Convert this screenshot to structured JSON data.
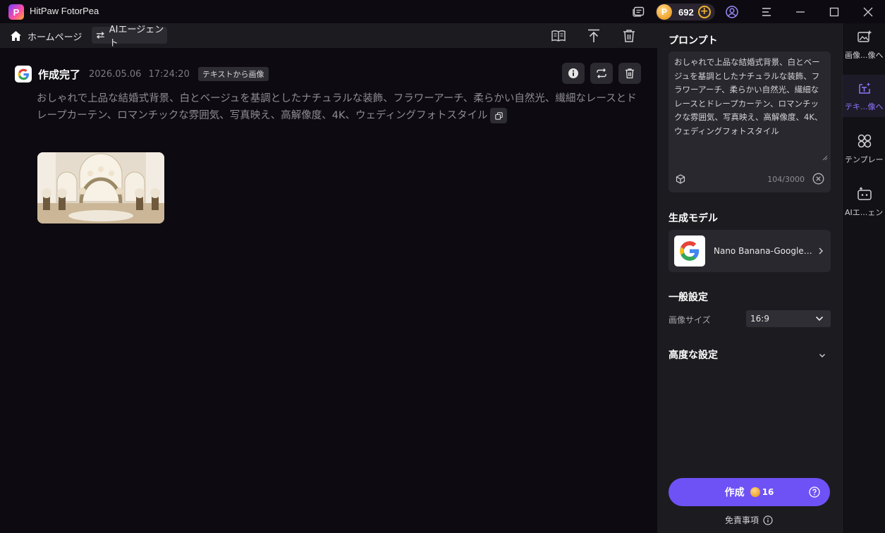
{
  "titlebar": {
    "app_name": "HitPaw FotorPea",
    "logo_letter": "P",
    "coin_symbol": "P",
    "coin_count": "692",
    "coin_plus": "+"
  },
  "toolbar": {
    "home_label": "ホームページ",
    "agent_label": "AIエージェント"
  },
  "result": {
    "title": "作成完了",
    "date": "2026.05.06",
    "time": "17:24:20",
    "tag": "テキストから画像",
    "prompt": "おしゃれで上品な結婚式背景、白とベージュを基調としたナチュラルな装飾、フラワーアーチ、柔らかい自然光、繊細なレースとドレープカーテン、ロマンチックな雰囲気、写真映え、高解像度、4K、ウェディングフォトスタイル"
  },
  "panel": {
    "prompt_title": "プロンプト",
    "prompt_value": "おしゃれで上品な結婚式背景、白とベージュを基調としたナチュラルな装飾、フラワーアーチ、柔らかい自然光、繊細なレースとドレープカーテン、ロマンチックな雰囲気、写真映え、高解像度、4K、ウェディングフォトスタイル",
    "char_count": "104/3000",
    "model_title": "生成モデル",
    "model_name": "Nano Banana-Google:...",
    "general_title": "一般設定",
    "size_label": "画像サイズ",
    "size_value": "16:9",
    "advanced_title": "高度な設定",
    "generate_label": "作成",
    "generate_cost": "16",
    "disclaimer": "免責事項"
  },
  "side_nav": [
    {
      "label": "画像...像へ"
    },
    {
      "label": "テキ...像へ"
    },
    {
      "label": "テンプレート"
    },
    {
      "label": "AIエ...ェント"
    }
  ],
  "colors": {
    "accent": "#6e52f5",
    "active_nav": "#8e74ff",
    "coin": "#f0a22a",
    "background": "#0d0b11",
    "panel": "#1c1b20"
  }
}
